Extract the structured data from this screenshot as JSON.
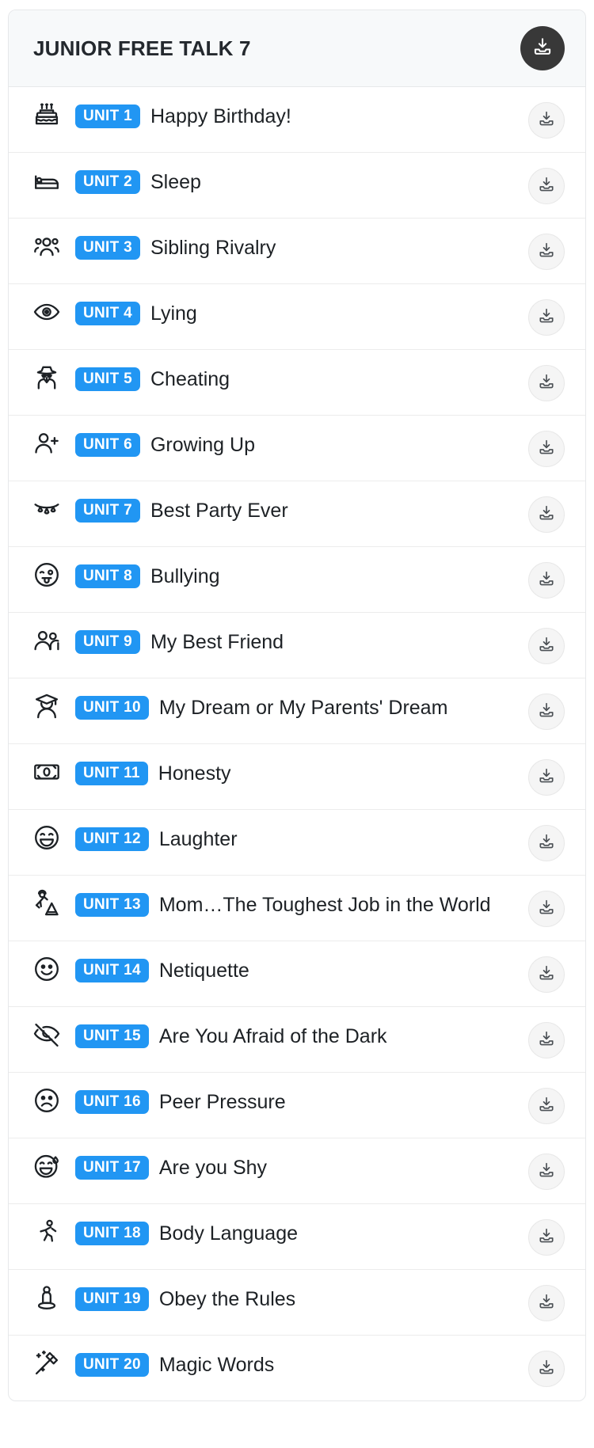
{
  "header": {
    "title": "JUNIOR FREE TALK 7",
    "download_all_icon": "download-tray-icon"
  },
  "row_download_icon": "download-tray-icon",
  "theme": {
    "badge_blue": "#2196f3",
    "header_bg": "#f7f9fa",
    "dark_button": "#383838",
    "row_button_bg": "#f5f5f5",
    "text": "#1d2125"
  },
  "units": [
    {
      "badge": "UNIT 1",
      "title": "Happy Birthday!",
      "icon": "birthday-cake-icon"
    },
    {
      "badge": "UNIT 2",
      "title": "Sleep",
      "icon": "bed-icon"
    },
    {
      "badge": "UNIT 3",
      "title": "Sibling Rivalry",
      "icon": "group-three-people-icon"
    },
    {
      "badge": "UNIT 4",
      "title": "Lying",
      "icon": "eye-icon"
    },
    {
      "badge": "UNIT 5",
      "title": "Cheating",
      "icon": "spy-detective-icon"
    },
    {
      "badge": "UNIT 6",
      "title": "Growing Up",
      "icon": "person-add-icon"
    },
    {
      "badge": "UNIT 7",
      "title": "Best Party Ever",
      "icon": "party-garland-icon"
    },
    {
      "badge": "UNIT 8",
      "title": "Bullying",
      "icon": "tongue-wink-face-icon"
    },
    {
      "badge": "UNIT 9",
      "title": "My Best Friend",
      "icon": "two-people-icon"
    },
    {
      "badge": "UNIT 10",
      "title": "My Dream or My Parents' Dream",
      "icon": "graduate-icon"
    },
    {
      "badge": "UNIT 11",
      "title": "Honesty",
      "icon": "banknote-icon"
    },
    {
      "badge": "UNIT 12",
      "title": "Laughter",
      "icon": "laughing-face-icon"
    },
    {
      "badge": "UNIT 13",
      "title": "Mom…The Toughest Job in the World",
      "icon": "construction-worker-icon"
    },
    {
      "badge": "UNIT 14",
      "title": "Netiquette",
      "icon": "wink-smile-face-icon"
    },
    {
      "badge": "UNIT 15",
      "title": "Are You Afraid of the Dark",
      "icon": "eye-off-icon"
    },
    {
      "badge": "UNIT 16",
      "title": "Peer Pressure",
      "icon": "sad-face-icon"
    },
    {
      "badge": "UNIT 17",
      "title": "Are you Shy",
      "icon": "sweat-smile-face-icon"
    },
    {
      "badge": "UNIT 18",
      "title": "Body Language",
      "icon": "running-person-icon"
    },
    {
      "badge": "UNIT 19",
      "title": "Obey the Rules",
      "icon": "person-on-pedestal-icon"
    },
    {
      "badge": "UNIT 20",
      "title": "Magic Words",
      "icon": "magic-wand-icon"
    }
  ]
}
